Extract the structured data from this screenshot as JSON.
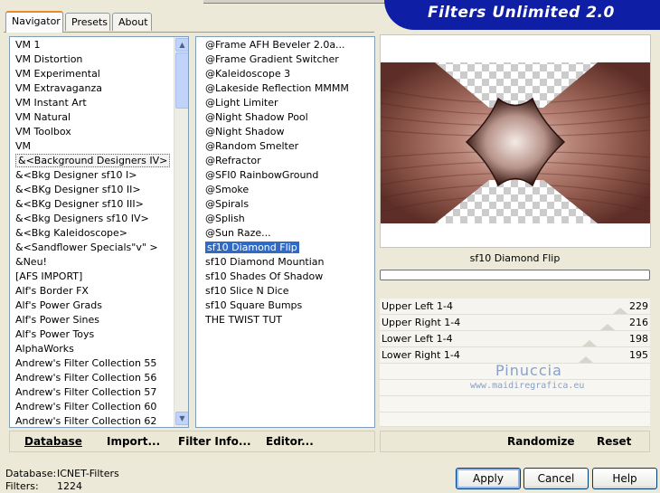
{
  "title": "Filters Unlimited 2.0",
  "tabs": [
    {
      "label": "Navigator",
      "active": true
    },
    {
      "label": "Presets",
      "active": false
    },
    {
      "label": "About",
      "active": false
    }
  ],
  "categories": [
    "VM 1",
    "VM Distortion",
    "VM Experimental",
    "VM Extravaganza",
    "VM Instant Art",
    "VM Natural",
    "VM Toolbox",
    "VM",
    "&<Background Designers IV>",
    "&<Bkg Designer sf10 I>",
    "&<BKg Designer sf10 II>",
    "&<BKg Designer sf10 III>",
    "&<Bkg Designers sf10 IV>",
    "&<Bkg Kaleidoscope>",
    "&<Sandflower Specials\"v\" >",
    "&Neu!",
    "[AFS IMPORT]",
    "Alf's Border FX",
    "Alf's Power Grads",
    "Alf's Power Sines",
    "Alf's Power Toys",
    "AlphaWorks",
    "Andrew's Filter Collection 55",
    "Andrew's Filter Collection 56",
    "Andrew's Filter Collection 57",
    "Andrew's Filter Collection 60",
    "Andrew's Filter Collection 62"
  ],
  "filters": [
    "@Frame AFH Beveler 2.0a...",
    "@Frame Gradient Switcher",
    "@Kaleidoscope 3",
    "@Lakeside Reflection MMMM",
    "@Light Limiter",
    "@Night Shadow Pool",
    "@Night Shadow",
    "@Random Smelter",
    "@Refractor",
    "@SFI0 RainbowGround",
    "@Smoke",
    "@Spirals",
    "@Splish",
    "@Sun Raze...",
    "sf10 Diamond Flip",
    "sf10 Diamond Mountian",
    "sf10 Shades Of Shadow",
    "sf10 Slice N Dice",
    "sf10 Square Bumps",
    "THE TWIST TUT"
  ],
  "selected_filter": "sf10 Diamond Flip",
  "sliders": [
    {
      "label": "Upper Left 1-4",
      "value": "229",
      "level": 0.898
    },
    {
      "label": "Upper Right 1-4",
      "value": "216",
      "level": 0.847
    },
    {
      "label": "Lower Left 1-4",
      "value": "198",
      "level": 0.776
    },
    {
      "label": "Lower Right 1-4",
      "value": "195",
      "level": 0.765
    }
  ],
  "watermark": {
    "name": "Pinuccia",
    "site": "www.maidiregrafica.eu"
  },
  "toolbar": {
    "database": "Database",
    "import": "Import...",
    "filter_info": "Filter Info...",
    "editor": "Editor...",
    "randomize": "Randomize",
    "reset": "Reset"
  },
  "status": {
    "database_label": "Database:",
    "database_value": "ICNET-Filters",
    "filters_label": "Filters:",
    "filters_value": "1224"
  },
  "buttons": {
    "apply": "Apply",
    "cancel": "Cancel",
    "help": "Help"
  }
}
